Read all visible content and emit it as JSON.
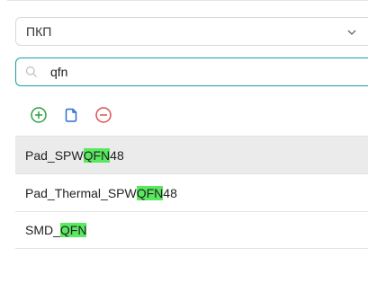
{
  "colors": {
    "accent": "#1aa0a6",
    "highlight": "#59e85f",
    "add_icon": "#2aa043",
    "copy_icon": "#2a6fd6",
    "remove_icon": "#d9534f",
    "selected_row": "#ebebeb"
  },
  "library_select": {
    "value": "ПКП",
    "icon": "chevron-down-icon"
  },
  "search": {
    "icon": "search-icon",
    "value": "qfn"
  },
  "toolbar": {
    "add_icon": "plus-circle-icon",
    "copy_icon": "document-copy-icon",
    "remove_icon": "minus-circle-icon"
  },
  "list": {
    "items": [
      {
        "prefix": "Pad_SPW",
        "match": "QFN",
        "suffix": "48",
        "selected": true
      },
      {
        "prefix": "Pad_Thermal_SPW",
        "match": "QFN",
        "suffix": "48",
        "selected": false
      },
      {
        "prefix": "SMD_",
        "match": "QFN",
        "suffix": "",
        "selected": false
      }
    ]
  }
}
